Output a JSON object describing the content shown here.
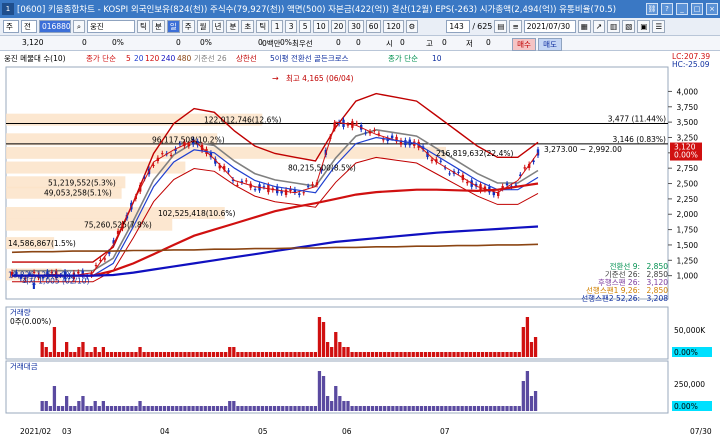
{
  "window": {
    "index": "1",
    "title": "[0600] 키움종합차트 - KOSPI 외국인보유(824(천)) 주식수(79,927(천)) 액면(500) 자본금(422(억)) 결산(12월) EPS(-263) 시가총액(2,494(억)) 유통비율(70.5)"
  },
  "toolbar": {
    "type_label": "주",
    "market_label": "전",
    "code": "016880",
    "name": "웅진",
    "period_buttons": [
      "틱",
      "분",
      "일",
      "주",
      "월",
      "년",
      "분",
      "초",
      "틱"
    ],
    "selected_period": "일",
    "interval_buttons": [
      "1",
      "3",
      "5",
      "10",
      "20",
      "30",
      "60",
      "120"
    ],
    "count": "143",
    "total": "625",
    "date": "2021/07/30"
  },
  "quote": {
    "price": "3,120",
    "change": "0",
    "change_pct": "0%",
    "volume": "0",
    "pct1": "0%",
    "val2": "0",
    "pct2": "0%",
    "val3": "0",
    "amount_label": "0백만",
    "priority_label": "최우선",
    "open_label": "시",
    "open": "0",
    "high_label": "고",
    "high": "0",
    "low_label": "저",
    "low": "0",
    "buy_button": "매수",
    "sell_button": "매도"
  },
  "legend": {
    "item1": "웅진 메물대 수(10)",
    "item2_label": "종가 단순",
    "ma_values": [
      "5",
      "20",
      "120",
      "240",
      "480"
    ],
    "item3": "기준선 26",
    "item4": "상한선",
    "item5": "5이평 전환선 골든크로스",
    "item6": "종가 단순",
    "item6_val": "10",
    "lc": "LC:207.39",
    "hc": "HC:-25.09"
  },
  "colors": {
    "ma5": "#d01010",
    "ma20": "#2040d0",
    "ma120": "#d01010",
    "ma240": "#1010c0",
    "ma480": "#8b4513",
    "baseline": "#808080",
    "envelope": "#c00000",
    "volume_bar": "#d01010",
    "amount_bar": "#5a4aa0",
    "price_tag": "#d01010"
  },
  "chart_data": [
    {
      "type": "line",
      "title": "",
      "x": [
        "2021/02",
        "03",
        "04",
        "05",
        "06",
        "07"
      ],
      "ylim": [
        750,
        4300
      ],
      "y_ticks": [
        4000,
        3750,
        3500,
        3250,
        3000,
        2750,
        2500,
        2250,
        2000,
        1750,
        1500,
        1250,
        1000
      ],
      "y_tick_labels": [
        "4,000",
        "3,750",
        "3,500",
        "3,250",
        "3,000",
        "2,750",
        "2,500",
        "2,250",
        "2,000",
        "1,750",
        "1,500",
        "1,250",
        "1,000"
      ],
      "series": [
        {
          "name": "종가 단순 5",
          "values": [
            1000,
            1000,
            1020,
            1000,
            1050,
            1500,
            2200,
            2850,
            3050,
            3200,
            2900,
            2550,
            2450,
            2400,
            2350,
            2450,
            3500,
            3450,
            3300,
            3200,
            3150,
            2850,
            2650,
            2450,
            2350,
            2550,
            3000
          ]
        },
        {
          "name": "종가 단순 20",
          "values": [
            1000,
            1000,
            1000,
            1000,
            1000,
            1200,
            1800,
            2450,
            2850,
            3050,
            3000,
            2750,
            2550,
            2450,
            2400,
            2350,
            2800,
            3150,
            3250,
            3200,
            3150,
            2950,
            2750,
            2550,
            2400,
            2400,
            2600
          ]
        },
        {
          "name": "종가 단순 120",
          "values": [
            1000,
            1000,
            1000,
            1000,
            1000,
            1080,
            1200,
            1350,
            1500,
            1650,
            1750,
            1850,
            1950,
            2050,
            2120,
            2180,
            2250,
            2320,
            2360,
            2380,
            2400,
            2400,
            2390,
            2380,
            2400,
            2450,
            2500
          ]
        },
        {
          "name": "종가 단순 240",
          "values": [
            1000,
            1000,
            1000,
            1000,
            1000,
            1010,
            1050,
            1100,
            1150,
            1200,
            1250,
            1300,
            1350,
            1400,
            1450,
            1500,
            1550,
            1580,
            1610,
            1640,
            1670,
            1700,
            1720,
            1740,
            1760,
            1780,
            1800
          ]
        },
        {
          "name": "종가 단순 480",
          "values": [
            1380,
            1390,
            1390,
            1400,
            1400,
            1400,
            1410,
            1410,
            1420,
            1420,
            1430,
            1430,
            1440,
            1440,
            1450,
            1450,
            1460,
            1460,
            1470,
            1470,
            1480,
            1480,
            1490,
            1490,
            1500,
            1500,
            1510
          ]
        }
      ],
      "price_levels": [
        {
          "label": "3,477 (11.44%)",
          "value": 3477
        },
        {
          "label": "3,146 (0.83%)",
          "value": 3146
        }
      ],
      "price_tag": "3,120",
      "price_tag_2": "0.00%",
      "peak_annotation": "최고 4,165 (06/04)",
      "volume_profile": [
        {
          "label": "122,012,746(12.6%)",
          "price": 3540
        },
        {
          "label": "96,117,508(10.2%)",
          "price": 3220
        },
        {
          "label": "80,215,500(8.5%)",
          "price": 2760
        },
        {
          "label": "216,819,632(22.4%)",
          "price": 3000
        },
        {
          "label": "51,219,552(5.3%)",
          "price": 2520
        },
        {
          "label": "49,053,258(5.1%)",
          "price": 2350
        },
        {
          "label": "102,525,418(10.6%)",
          "price": 2020
        },
        {
          "label": "75,260,525(7.8%)",
          "price": 1830
        },
        {
          "label": "14,586,867(1.5%)",
          "price": 1530
        },
        {
          "label": "18,826,126(1.9%)",
          "price": 1020
        }
      ],
      "range_annotation": "3,273.00 ~ 2,992.00",
      "low_annotation": "최저 1,005 (02/10)",
      "readout": [
        {
          "label": "전환선 9:",
          "value": "2,850"
        },
        {
          "label": "기준선 26:",
          "value": "2,850"
        },
        {
          "label": "후행스팬 26:",
          "value": "3,120"
        },
        {
          "label": "선행스팬1 9,26:",
          "value": "2,850"
        },
        {
          "label": "선행스팬2 52,26:",
          "value": "3,208"
        }
      ]
    },
    {
      "type": "bar",
      "title": "거래량",
      "subtitle": "0주(0.00%)",
      "y_tick_labels": [
        "50,000K",
        "0.00%"
      ],
      "values": [
        0,
        0,
        0,
        0,
        0,
        0,
        0,
        3,
        2,
        1,
        6,
        1,
        1,
        3,
        1,
        1,
        2,
        3,
        1,
        1,
        2,
        1,
        2,
        1,
        1,
        1,
        1,
        1,
        1,
        1,
        1,
        2,
        1,
        1,
        1,
        1,
        1,
        1,
        1,
        1,
        1,
        1,
        1,
        1,
        1,
        1,
        1,
        1,
        1,
        1,
        1,
        1,
        1,
        2,
        2,
        1,
        1,
        1,
        1,
        1,
        1,
        1,
        1,
        1,
        1,
        1,
        1,
        1,
        1,
        1,
        1,
        1,
        1,
        1,
        1,
        8,
        7,
        3,
        2,
        5,
        3,
        2,
        2,
        1,
        1,
        1,
        1,
        1,
        1,
        1,
        1,
        1,
        1,
        1,
        1,
        1,
        1,
        1,
        1,
        1,
        1,
        1,
        1,
        1,
        1,
        1,
        1,
        1,
        1,
        1,
        1,
        1,
        1,
        1,
        1,
        1,
        1,
        1,
        1,
        1,
        1,
        1,
        1,
        1,
        1,
        6,
        8,
        3,
        4
      ]
    },
    {
      "type": "bar",
      "title": "거래대금",
      "y_tick_labels": [
        "250,000",
        "0.00%"
      ],
      "values": [
        0,
        0,
        0,
        0,
        0,
        0,
        0,
        2,
        2,
        1,
        5,
        1,
        1,
        3,
        1,
        1,
        2,
        3,
        1,
        1,
        2,
        1,
        2,
        1,
        1,
        1,
        1,
        1,
        1,
        1,
        1,
        2,
        1,
        1,
        1,
        1,
        1,
        1,
        1,
        1,
        1,
        1,
        1,
        1,
        1,
        1,
        1,
        1,
        1,
        1,
        1,
        1,
        1,
        2,
        2,
        1,
        1,
        1,
        1,
        1,
        1,
        1,
        1,
        1,
        1,
        1,
        1,
        1,
        1,
        1,
        1,
        1,
        1,
        1,
        1,
        8,
        7,
        3,
        2,
        5,
        3,
        2,
        2,
        1,
        1,
        1,
        1,
        1,
        1,
        1,
        1,
        1,
        1,
        1,
        1,
        1,
        1,
        1,
        1,
        1,
        1,
        1,
        1,
        1,
        1,
        1,
        1,
        1,
        1,
        1,
        1,
        1,
        1,
        1,
        1,
        1,
        1,
        1,
        1,
        1,
        1,
        1,
        1,
        1,
        1,
        6,
        8,
        3,
        4
      ]
    }
  ],
  "x_axis": {
    "labels": [
      "2021/02",
      "03",
      "04",
      "05",
      "06",
      "07"
    ],
    "right_label": "07/30"
  }
}
